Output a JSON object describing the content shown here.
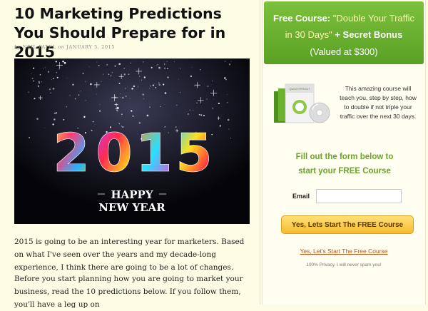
{
  "article": {
    "title": "10 Marketing Predictions You Should Prepare for in 2015",
    "byline_prefix": "by",
    "author": "NEIL PATEL",
    "byline_on": "on",
    "date": "JANUARY 5, 2015",
    "hero": {
      "year_text": "2015",
      "greeting_line1": "HAPPY",
      "greeting_line2": "NEW YEAR"
    },
    "paragraphs": [
      "2015 is going to be an interesting year for marketers. Based on what I've seen over the years and my decade-long experience, I think there are going to be a lot of changes.",
      "Before you start planning how you are going to market your business, read the 10 predictions below. If you follow them, you'll have a leg up on"
    ]
  },
  "sidebar": {
    "banner": {
      "free_course": "Free Course:",
      "quote": "\"Double Your Traffic",
      "quote2": "in 30 Days\"",
      "bonus": "+ Secret Bonus",
      "value": "(Valued at $300)"
    },
    "product": {
      "box_label": "QUICKSPROUT",
      "description": "This amazing course will teach you, step by step, how to double if not triple your traffic over the next 30 days."
    },
    "cta_heading_line1": "Fill out the form below to",
    "cta_heading_line2": "start your FREE Course",
    "email_label": "Email",
    "email_placeholder": "",
    "submit_label": "Yes, Lets Start The FREE Course",
    "link_label": "Yes, Let's Start The Free Course",
    "privacy_text": "100% Privacy. I will never spam you!"
  },
  "colors": {
    "banner_green": "#6cb22e",
    "heading_green": "#6aa52a",
    "button_yellow": "#f7bb2d",
    "link_orange": "#b2561a",
    "page_bg": "#fdfde6"
  }
}
